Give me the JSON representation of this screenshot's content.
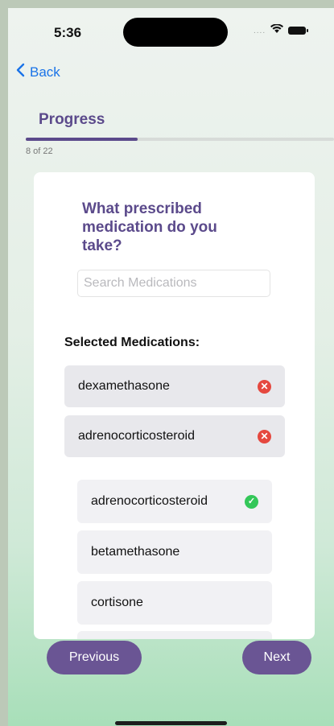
{
  "status_bar": {
    "time": "5:36",
    "signal_dots": "....",
    "colors": {
      "battery": "#111111"
    }
  },
  "nav": {
    "back_label": "Back",
    "back_icon": "chevron-left-icon"
  },
  "progress": {
    "title": "Progress",
    "current": 8,
    "total": 22,
    "count_label": "8 of 22",
    "fraction": 0.364
  },
  "question": {
    "title": "What prescribed medication do you take?",
    "search": {
      "placeholder": "Search Medications",
      "value": ""
    }
  },
  "selected": {
    "heading": "Selected Medications:",
    "items": [
      {
        "label": "dexamethasone",
        "icon": "remove-icon"
      },
      {
        "label": "adrenocorticosteroid",
        "icon": "remove-icon"
      }
    ]
  },
  "options": [
    {
      "label": "adrenocorticosteroid",
      "selected": true,
      "icon": "check-icon"
    },
    {
      "label": "betamethasone",
      "selected": false
    },
    {
      "label": "cortisone",
      "selected": false
    }
  ],
  "footer": {
    "previous_label": "Previous",
    "next_label": "Next"
  },
  "colors": {
    "accent": "#5b4a8b",
    "button": "#6a5594",
    "remove": "#e5483f",
    "check": "#34c759"
  }
}
